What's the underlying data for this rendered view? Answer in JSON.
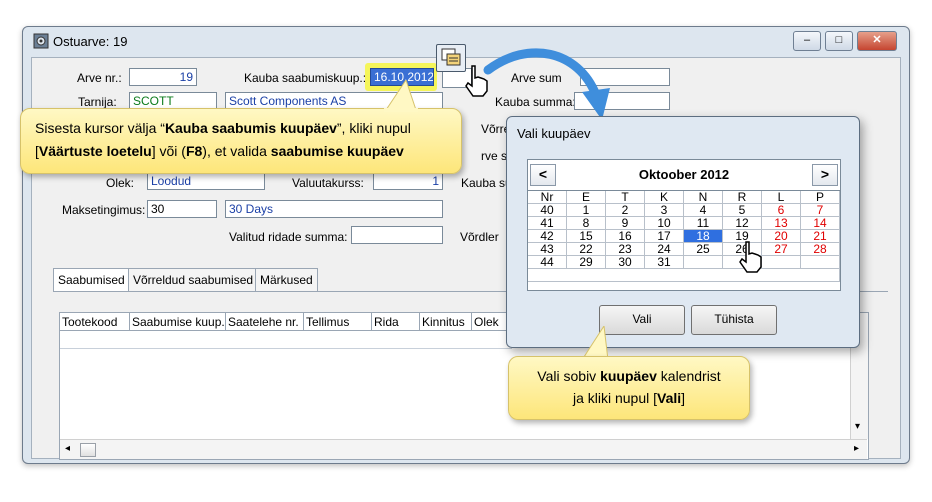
{
  "window": {
    "title": "Ostuarve: 19",
    "minimize_glyph": "–",
    "maximize_glyph": "□",
    "close_glyph": "✕"
  },
  "form": {
    "arve_nr_label": "Arve nr.:",
    "arve_nr_value": "19",
    "kauba_saabumiskuup_label": "Kauba saabumiskuup.:",
    "kauba_saabumiskuup_value": "16.10.2012",
    "arve_summa_label": "Arve sum",
    "tarnija_label": "Tarnija:",
    "tarnija_code": "SCOTT",
    "tarnija_name": "Scott Components AS",
    "kauba_summa_label": "Kauba summa:",
    "vorre_label": "Võrre",
    "arve_su_label": "rve su",
    "olek_label": "Olek:",
    "olek_value": "Loodud",
    "valuutakurss_label": "Valuutakurss:",
    "valuutakurss_value": "1",
    "kauba_su_label": "Kauba su",
    "maksetingimus_label": "Maksetingimus:",
    "maksetingimus_code": "30",
    "maksetingimus_name": "30 Days",
    "valitud_label": "Valitud ridade summa:",
    "vordle_label": "Võrdler"
  },
  "tabs": [
    "Saabumised",
    "Võrreldud saabumised",
    "Märkused"
  ],
  "grid_columns": [
    "Tootekood",
    "Saabumise kuup.",
    "Saatelehe nr.",
    "Tellimus",
    "Rida",
    "Kinnitus",
    "Olek"
  ],
  "callout_top": {
    "t1": "Sisesta kursor välja “",
    "b1": "Kauba saabumis kuupäev",
    "t2": "”, kliki nupul",
    "t3": "[",
    "b2": "Väärtuste loetelu",
    "t4": "] või (",
    "b3": "F8",
    "t5": "), et valida ",
    "b4": "saabumise kuupäev"
  },
  "callout_bottom": {
    "t1": "Vali sobiv ",
    "b1": "kuupäev",
    "t2": " kalendrist",
    "t3": "ja kliki nupul [",
    "b2": "Vali",
    "t4": "]"
  },
  "dialog": {
    "title": "Vali kuupäev",
    "month_title": "Oktoober 2012",
    "prev": "<",
    "next": ">",
    "ok_label": "Vali",
    "cancel_label": "Tühista"
  },
  "calendar": {
    "headers": [
      "Nr",
      "E",
      "T",
      "K",
      "N",
      "R",
      "L",
      "P"
    ],
    "rows": [
      [
        "40",
        "1",
        "2",
        "3",
        "4",
        "5",
        "6",
        "7"
      ],
      [
        "41",
        "8",
        "9",
        "10",
        "11",
        "12",
        "13",
        "14"
      ],
      [
        "42",
        "15",
        "16",
        "17",
        "18",
        "19",
        "20",
        "21"
      ],
      [
        "43",
        "22",
        "23",
        "24",
        "25",
        "26",
        "27",
        "28"
      ],
      [
        "44",
        "29",
        "30",
        "31",
        "",
        "",
        "",
        ""
      ]
    ],
    "selected_day": "18",
    "weekend_color": "#e00000",
    "selected_color": "#2f6fe0"
  }
}
